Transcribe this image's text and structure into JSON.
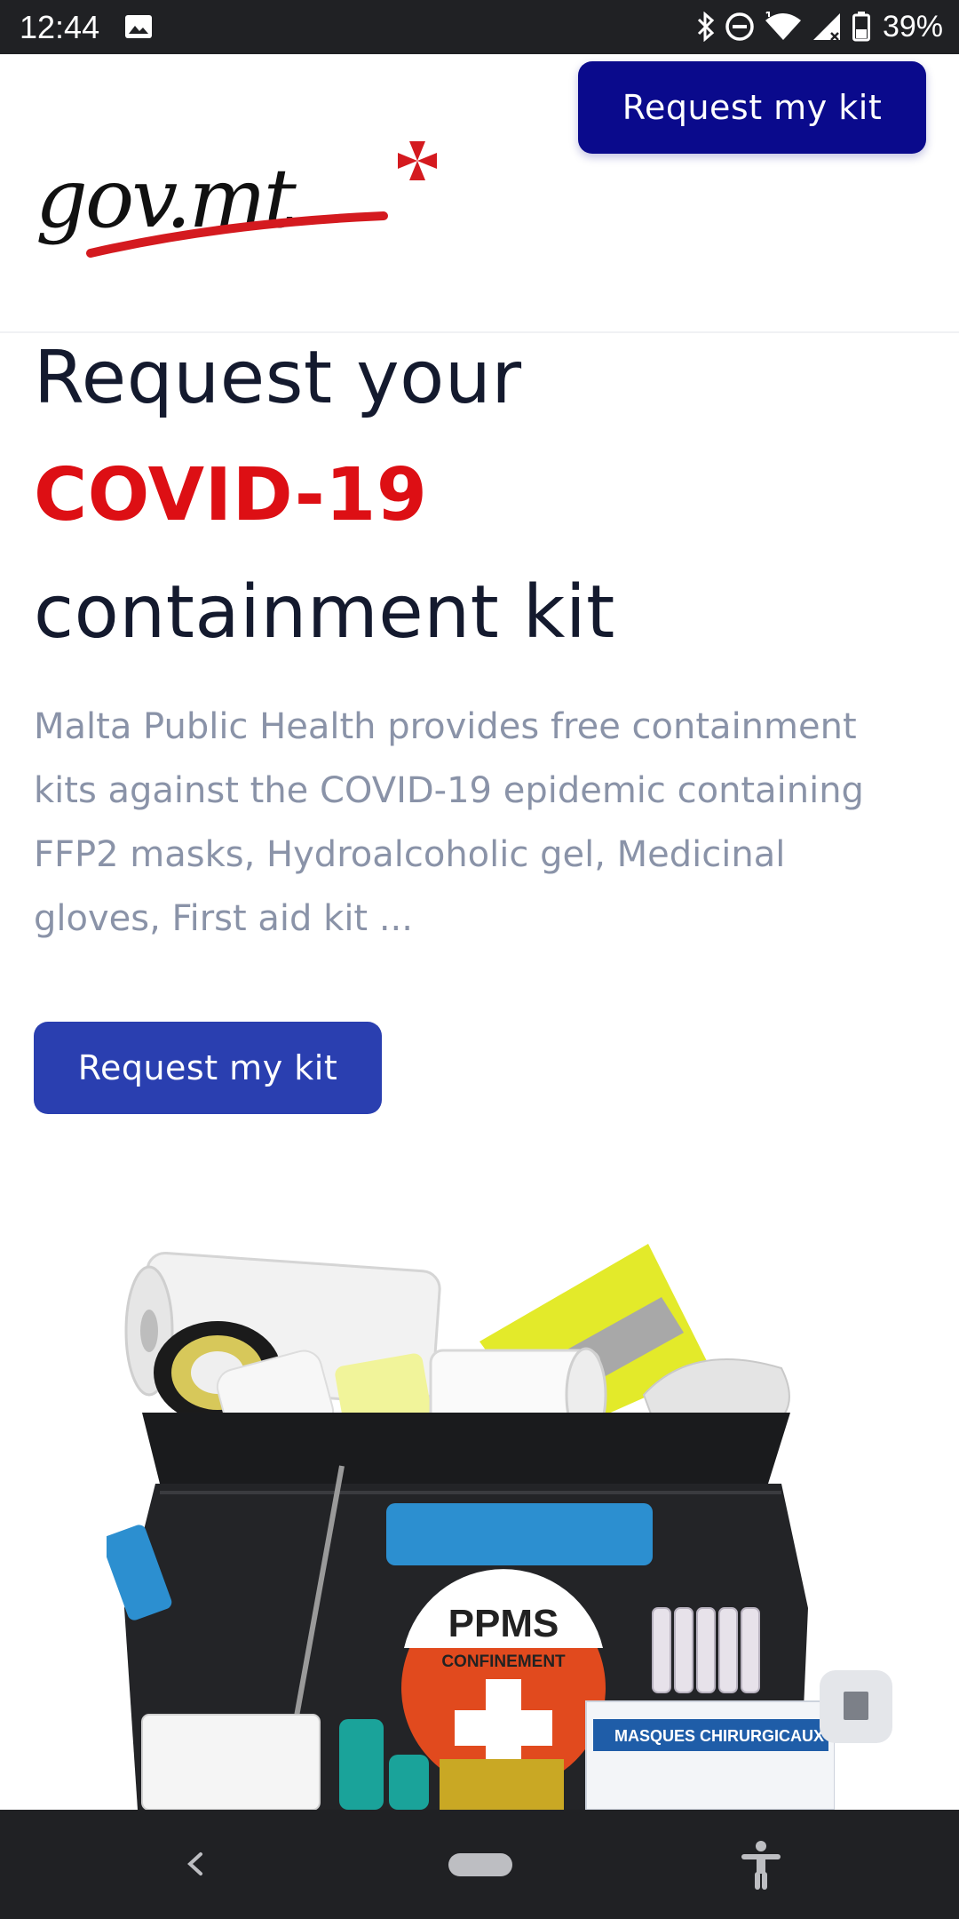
{
  "status_bar": {
    "time": "12:44",
    "battery": "39%",
    "icons": [
      "image-icon",
      "bluetooth-icon",
      "do-not-disturb-icon",
      "wifi-icon",
      "cell-signal-icon",
      "battery-icon"
    ]
  },
  "header": {
    "logo_text": "gov.mt",
    "cta_label": "Request my kit"
  },
  "hero": {
    "title_line1": "Request your",
    "title_accent": "COVID-19",
    "title_line3": "containment kit",
    "description": "Malta Public Health provides free containment kits against the COVID-19 epidemic containing FFP2 masks, Hydroalcoholic gel, Medicinal gloves, First aid kit ...",
    "cta_label": "Request my kit"
  },
  "kit_image": {
    "badge_title": "PPMS",
    "badge_subtitle": "CONFINEMENT",
    "box_label": "MASQUES CHIRURGICAUX"
  },
  "colors": {
    "primary_dark": "#0a0a8c",
    "primary": "#2a3fb0",
    "accent_red": "#dd0f14",
    "title": "#141a2e",
    "body_text": "#8a93a8"
  },
  "nav_bar": {
    "icons": [
      "back-icon",
      "home-pill-icon",
      "accessibility-icon"
    ]
  }
}
